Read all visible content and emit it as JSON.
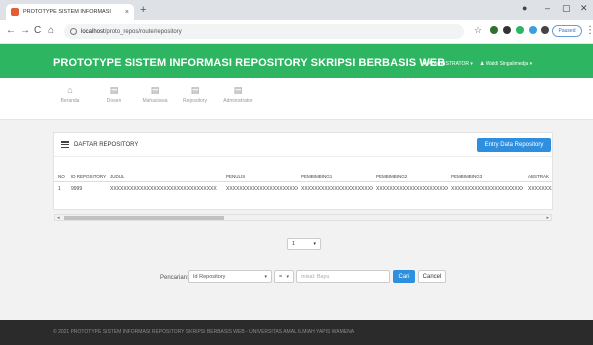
{
  "browser": {
    "tab_title": "PROTOTYPE SISTEM INFORMASI",
    "tab_close": "×",
    "new_tab": "+",
    "url_host": "localhost",
    "url_path": "/proto_repos/route/repository",
    "paused_label": "Paused",
    "nav_back": "←",
    "nav_forward": "→",
    "nav_reload": "C",
    "nav_home": "⌂",
    "star": "☆",
    "win_min": "–",
    "win_max": "▢",
    "win_close": "✕",
    "menu_dots": "⋮"
  },
  "header": {
    "title": "PROTOTYPE SISTEM INFORMASI REPOSITORY SKRIPSI BERBASIS WEB",
    "menu_admin": "ADMINISTRATOR",
    "menu_user": "Waldi Singalimedja"
  },
  "nav": {
    "items": [
      {
        "label": "Beranda",
        "icon": "home-icon"
      },
      {
        "label": "Dosen",
        "icon": "table-icon"
      },
      {
        "label": "Mahasiswa",
        "icon": "table-icon"
      },
      {
        "label": "Repository",
        "icon": "table-icon"
      },
      {
        "label": "Administrator",
        "icon": "table-icon"
      }
    ]
  },
  "panel": {
    "title": "DAFTAR REPOSITORY",
    "entry_button": "Entry Data Repository"
  },
  "table": {
    "columns": [
      "NO",
      "ID REPOSITORY",
      "JUDUL",
      "PENULIS",
      "PEMBIMBING1",
      "PEMBIMBING2",
      "PEMBIMBING3",
      "ABSTRAK"
    ],
    "rows": [
      [
        "1",
        "9999",
        "XXXXXXXXXXXXXXXXXXXXXXXXXXXXXXXX",
        "XXXXXXXXXXXXXXXXXXXXXX",
        "XXXXXXXXXXXXXXXXXXXXXX",
        "XXXXXXXXXXXXXXXXXXXXXX",
        "XXXXXXXXXXXXXXXXXXXXXX",
        "XXXXXXXXXX"
      ]
    ]
  },
  "pager": {
    "value": "1"
  },
  "search": {
    "label": "Pencarian:",
    "field_value": "Id Repository",
    "operator_value": "=",
    "input_placeholder": "misal: Bayu",
    "search_button": "Cari",
    "cancel_button": "Cancel"
  },
  "footer": {
    "text": "© 2021 PROTOTYPE SISTEM INFORMASI REPOSITORY SKRIPSI BERBASIS WEB - UNIVERSITAS AMAL ILMIAH YAPIS WAMENA"
  },
  "colors": {
    "header_green": "#2db562",
    "primary_blue": "#2e8fdf",
    "footer_dark": "#2b2b2b"
  }
}
